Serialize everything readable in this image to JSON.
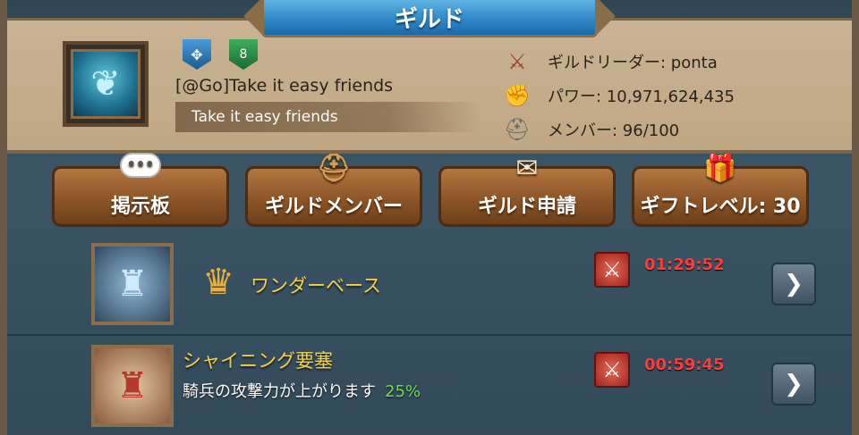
{
  "window": {
    "title": "ギルド"
  },
  "guild": {
    "emblem_icon": "jellyfish-icon",
    "badge_a_icon": "guild-rank-badge-icon",
    "badge_b_level": "8",
    "name": "[@Go]Take it easy friends",
    "description": "Take it easy friends"
  },
  "info": {
    "leader_label": "ギルドリーダー: ponta",
    "power_label": "パワー: 10,971,624,435",
    "members_label": "メンバー: 96/100"
  },
  "buttons": {
    "board": "掲示板",
    "members": "ギルドメンバー",
    "apply": "ギルド申請",
    "gift": "ギフトレベル: 30"
  },
  "rows": [
    {
      "title": "ワンダーベース",
      "subtitle": "",
      "timer": "01:29:52"
    },
    {
      "title": "シャイニング要塞",
      "subtitle": "騎兵の攻撃力が上がります",
      "percent": "25%",
      "timer": "00:59:45"
    }
  ],
  "colors": {
    "title_bar": "#2d84c3",
    "panel": "#c9b394",
    "button": "#8d5528",
    "timer": "#ff3b3b",
    "highlight": "#f3d24a",
    "percent": "#6be04a"
  }
}
